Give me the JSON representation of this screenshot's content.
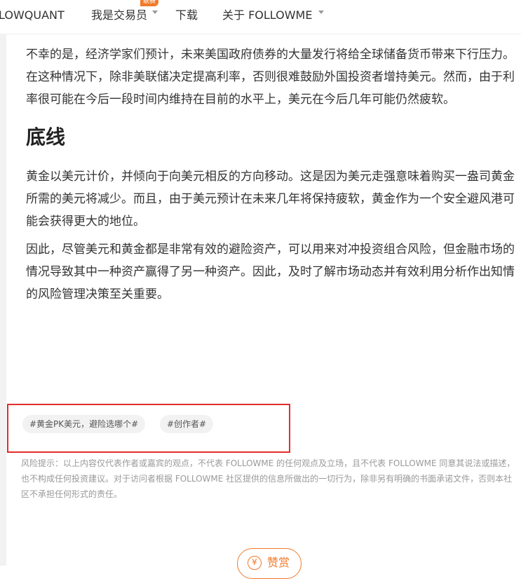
{
  "nav": {
    "brand": "LOWQUANT",
    "trader": "我是交易员",
    "trader_badge": "联赛",
    "download": "下载",
    "about": "关于 FOLLOWME"
  },
  "article": {
    "p1": "不幸的是，经济学家们预计，未来美国政府债券的大量发行将给全球储备货币带来下行压力。在这种情况下，除非美联储决定提高利率，否则很难鼓励外国投资者增持美元。然而，由于利率很可能在今后一段时间内维持在目前的水平上，美元在今后几年可能仍然疲软。",
    "heading": "底线",
    "p2": "黄金以美元计价，并倾向于向美元相反的方向移动。这是因为美元走强意味着购买一盎司黄金所需的美元将减少。而且，由于美元预计在未来几年将保持疲软，黄金作为一个安全避风港可能会获得更大的地位。",
    "p3": "因此，尽管美元和黄金都是非常有效的避险资产，可以用来对冲投资组合风险，但金融市场的情况导致其中一种资产赢得了另一种资产。因此，及时了解市场动态并有效利用分析作出知情的风险管理决策至关重要。"
  },
  "tags": [
    "#黄金PK美元，避险选哪个#",
    "#创作者#"
  ],
  "disclaimer": "风险提示：以上内容仅代表作者或嘉宾的观点，不代表 FOLLOWME 的任何观点及立场，且不代表 FOLLOWME 同意其说法或描述，也不构成任何投资建议。对于访问者根据 FOLLOWME 社区提供的信息所做出的一切行为，除非另有明确的书面承诺文件，否则本社区不承担任何形式的责任。",
  "reward": {
    "icon_glyph": "¥",
    "label": "赞赏"
  },
  "colors": {
    "accent": "#f07a2a",
    "highlight_border": "#e32c2c",
    "tag_bg": "#f2f2f2"
  }
}
